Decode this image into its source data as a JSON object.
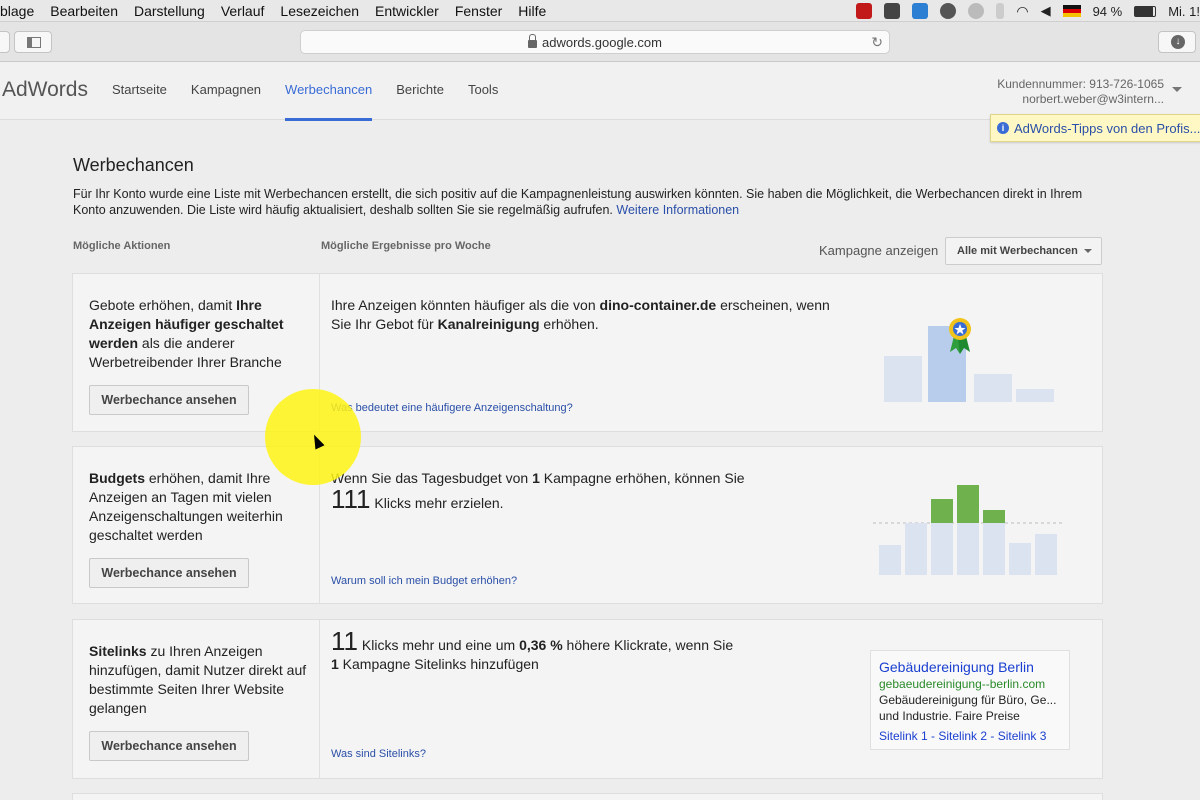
{
  "menubar": {
    "items": [
      "blage",
      "Bearbeiten",
      "Darstellung",
      "Verlauf",
      "Lesezeichen",
      "Entwickler",
      "Fenster",
      "Hilfe"
    ],
    "battery": "94 %",
    "clock": "Mi. 1!"
  },
  "browser": {
    "url": "adwords.google.com"
  },
  "app": {
    "logo": "AdWords",
    "tabs": [
      "Startseite",
      "Kampagnen",
      "Werbechancen",
      "Berichte",
      "Tools"
    ],
    "active_tab": "Werbechancen",
    "account_number": "Kundennummer: 913-726-1065",
    "account_email": "norbert.weber@w3intern...",
    "tips": "AdWords-Tipps von den Profis..."
  },
  "page": {
    "title": "Werbechancen",
    "intro": "Für Ihr Konto wurde eine Liste mit Werbechancen erstellt, die sich positiv auf die Kampagnenleistung auswirken könnten. Sie haben die Möglichkeit, die Werbechancen direkt in Ihrem Konto anzuwenden. Die Liste wird häufig aktualisiert, deshalb sollten Sie sie regelmäßig aufrufen.",
    "intro_link": "Weitere Informationen",
    "col_actions": "Mögliche Aktionen",
    "col_results": "Mögliche Ergebnisse pro Woche",
    "campaign_label": "Kampagne anzeigen",
    "campaign_select": "Alle mit Werbechancen",
    "button_label": "Werbechance ansehen"
  },
  "cards": [
    {
      "left_pre": "Gebote erhöhen, damit ",
      "left_bold": "Ihre Anzeigen häufiger geschaltet werden",
      "left_post": " als die anderer Werbetreibender Ihrer Branche",
      "main_1": "Ihre Anzeigen könnten häufiger als die von ",
      "main_bold_1": "dino-container.de",
      "main_2": " erscheinen, wenn Sie Ihr Gebot für ",
      "main_bold_2": "Kanalreinigung",
      "main_3": " erhöhen.",
      "link": "Was bedeutet eine häufigere Anzeigenschaltung?"
    },
    {
      "left_bold": "Budgets",
      "left_post": " erhöhen, damit Ihre Anzeigen an Tagen mit vielen Anzeigenschaltungen weiterhin geschaltet werden",
      "main_1": "Wenn Sie das Tagesbudget von ",
      "main_bold_1": "1",
      "main_2": " Kampagne erhöhen, können Sie",
      "big_num": "111",
      "main_3": "Klicks mehr erzielen.",
      "link": "Warum soll ich mein Budget erhöhen?"
    },
    {
      "left_bold": "Sitelinks",
      "left_post": " zu Ihren Anzeigen hinzufügen, damit Nutzer direkt auf bestimmte Seiten Ihrer Website gelangen",
      "big_num": "11",
      "main_1": "Klicks mehr und eine um ",
      "main_bold_1": "0,36 %",
      "main_2": " höhere Klickrate, wenn Sie",
      "main_bold_2": "1",
      "main_3": " Kampagne Sitelinks hinzufügen",
      "link": "Was sind Sitelinks?",
      "ad": {
        "title": "Gebäudereinigung Berlin",
        "url": "gebaeudereinigung--berlin.com",
        "desc1": "Gebäudereinigung für Büro, Ge...",
        "desc2": "und Industrie. Faire Preise",
        "sitelinks": "Sitelink 1 - Sitelink 2 - Sitelink 3"
      }
    }
  ],
  "colors": {
    "accent": "#3a6cd6",
    "bar_light": "#dbe3f0",
    "bar_blue": "#b7cdeb",
    "bar_green": "#6fb24d"
  }
}
